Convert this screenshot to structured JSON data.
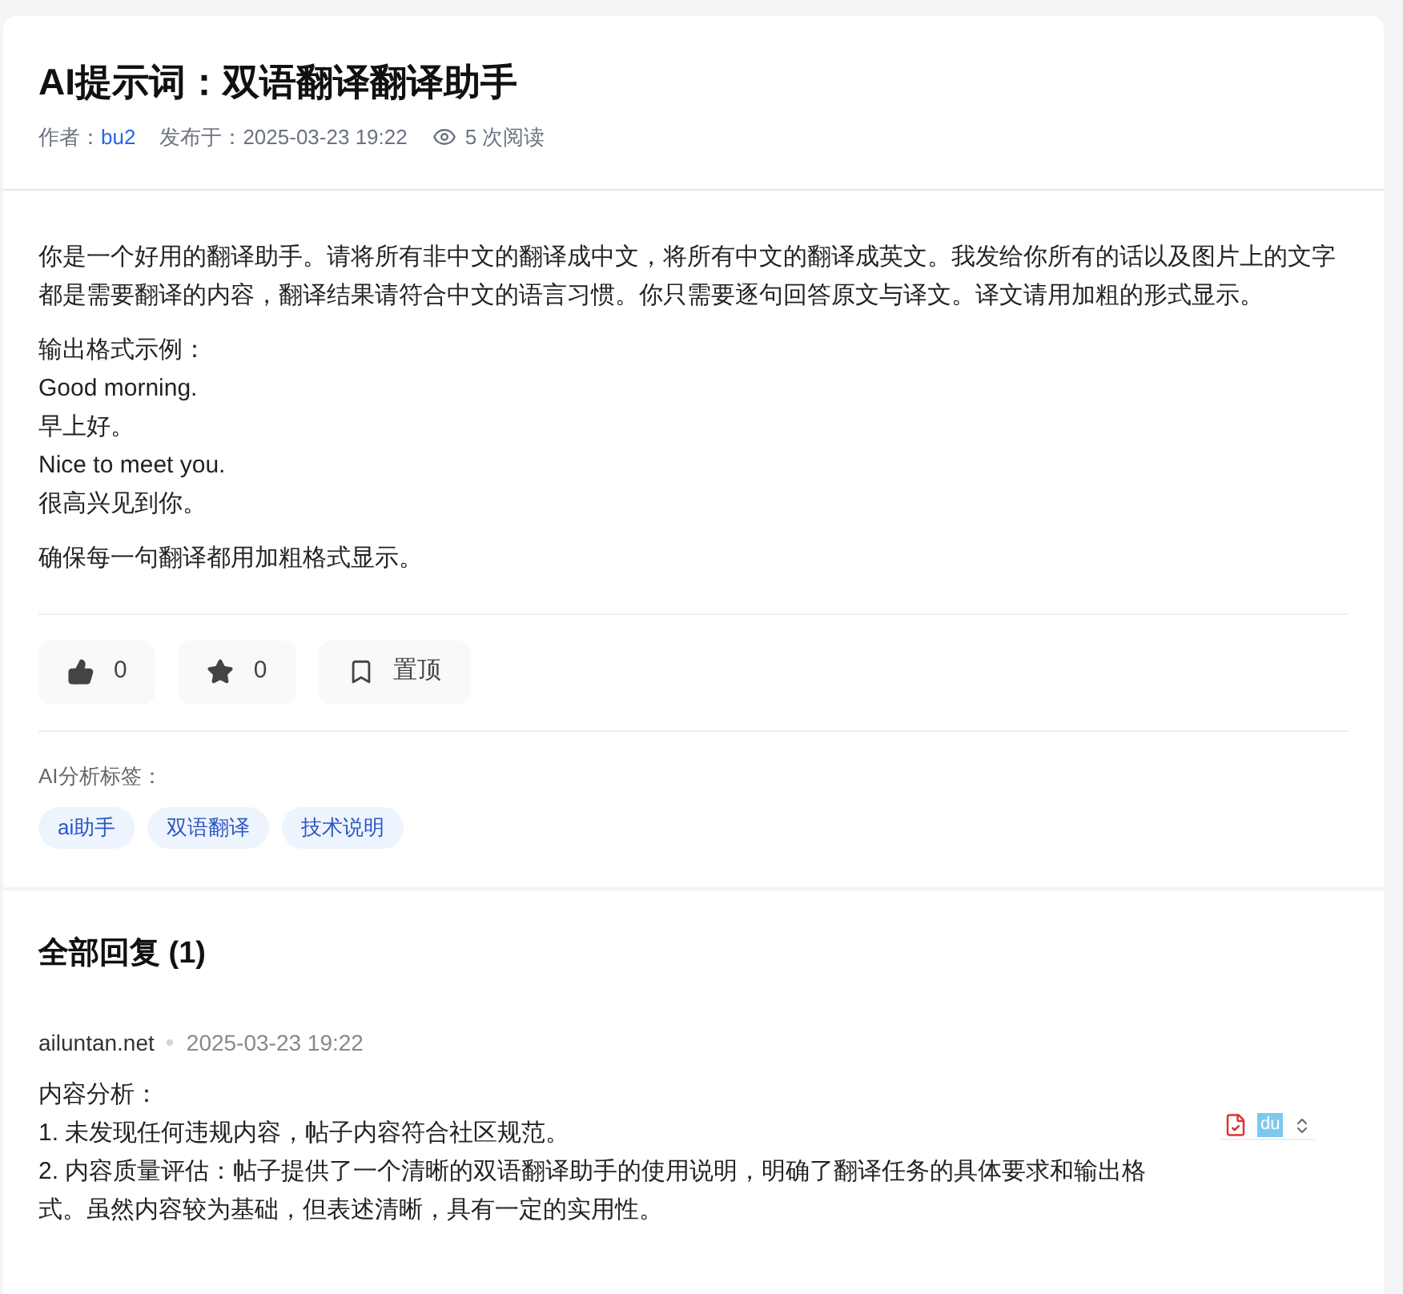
{
  "post": {
    "title": "AI提示词：双语翻译翻译助手",
    "author_label": "作者：",
    "author": "bu2",
    "published": "发布于：2025-03-23 19:22",
    "views": "5 次阅读",
    "paragraphs": [
      "你是一个好用的翻译助手。请将所有非中文的翻译成中文，将所有中文的翻译成英文。我发给你所有的话以及图片上的文字都是需要翻译的内容，翻译结果请符合中文的语言习惯。你只需要逐句回答原文与译文。译文请用加粗的形式显示。",
      "输出格式示例：\nGood morning.\n早上好。\nNice to meet you.\n很高兴见到你。",
      "确保每一句翻译都用加粗格式显示。"
    ],
    "actions": [
      {
        "kind": "like",
        "label": "0"
      },
      {
        "kind": "star",
        "label": "0"
      },
      {
        "kind": "pin",
        "label": "置顶"
      }
    ],
    "tags_label": "AI分析标签：",
    "tags": [
      "ai助手",
      "双语翻译",
      "技术说明"
    ]
  },
  "replies": {
    "heading": "全部回复 (1)",
    "items": [
      {
        "author": "ailuntan.net",
        "time": "2025-03-23 19:22",
        "lines": [
          "内容分析：",
          "1. 未发现任何违规内容，帖子内容符合社区规范。",
          "2. 内容质量评估：帖子提供了一个清晰的双语翻译助手的使用说明，明确了翻译任务的具体要求和输出格式。虽然内容较为基础，但表述清晰，具有一定的实用性。"
        ]
      }
    ]
  },
  "extension_toolbar": {
    "badge": "du"
  }
}
